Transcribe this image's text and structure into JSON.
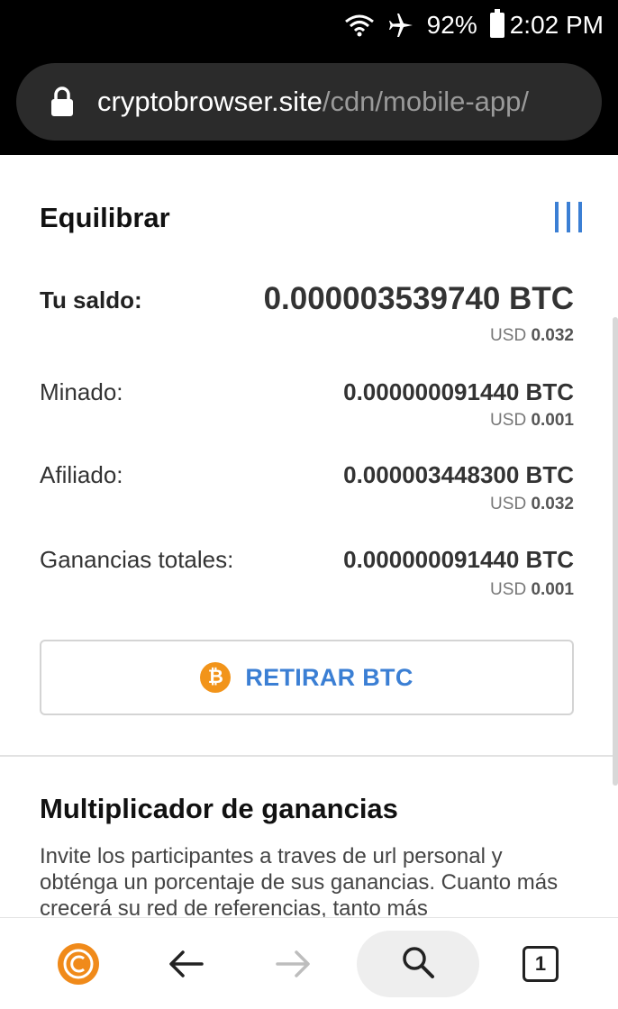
{
  "status_bar": {
    "battery": "92%",
    "time": "2:02 PM",
    "icons": [
      "wifi-icon",
      "airplane-icon",
      "battery-icon"
    ]
  },
  "address_bar": {
    "host": "cryptobrowser.site",
    "path": "/cdn/mobile-app/",
    "icon": "lock-icon"
  },
  "balance": {
    "title": "Equilibrar",
    "menu_icon": "menu-bars-icon",
    "rows": [
      {
        "label": "Tu saldo:",
        "btc": "0.000003539740 BTC",
        "usd_prefix": "USD",
        "usd": "0.032"
      },
      {
        "label": "Minado:",
        "btc": "0.000000091440 BTC",
        "usd_prefix": "USD",
        "usd": "0.001"
      },
      {
        "label": "Afiliado:",
        "btc": "0.000003448300 BTC",
        "usd_prefix": "USD",
        "usd": "0.032"
      },
      {
        "label": "Ganancias totales:",
        "btc": "0.000000091440 BTC",
        "usd_prefix": "USD",
        "usd": "0.001"
      }
    ],
    "withdraw_button": {
      "icon_glyph": "₿",
      "label": "RETIRAR BTC"
    }
  },
  "multiplier": {
    "title": "Multiplicador de ganancias",
    "description": "Invite los participantes a traves de url personal y obténga un porcentaje de sus ganancias. Cuanto más crecerá su red de referencias, tanto más"
  },
  "bottom_nav": {
    "tab_count": "1",
    "logo_glyph": "C",
    "icons": [
      "cryptotab-logo-icon",
      "back-arrow-icon",
      "forward-arrow-icon",
      "search-icon",
      "tabs-icon"
    ]
  },
  "colors": {
    "accent_blue": "#3b7fd4",
    "bitcoin_orange": "#f2941a",
    "toolbar_black": "#000000",
    "url_pill": "#2b2b2b"
  }
}
